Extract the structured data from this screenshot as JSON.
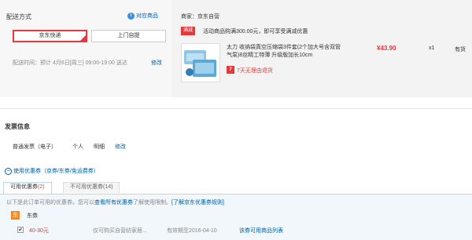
{
  "delivery": {
    "title": "配送方式",
    "help_icon": "info-icon",
    "help_link": "对应商品",
    "options": [
      {
        "label": "京东快递",
        "selected": true
      },
      {
        "label": "上门自提",
        "selected": false
      }
    ],
    "time_label": "配送时间：预计 4月6日[周三] 09:00-19:00 送达",
    "modify_link": "修改"
  },
  "merchant": {
    "label": "商家：京东自营",
    "promo_badge": "满减",
    "promo_text": "活动商品购满300.00元，即可享受满减优惠",
    "product": {
      "name": "太力 收纳袋真空压缩袋3件套(2个加大号含双管气泵)8丝精工特薄 升级版加长10cm",
      "price": "¥43.90",
      "qty": "x1",
      "stock": "有货",
      "return_icon": "7",
      "return_text": "7天无理由退货"
    }
  },
  "invoice": {
    "title": "发票信息",
    "type": "普通发票（电子）",
    "recipient": "个人",
    "content": "明细",
    "modify_link": "修改"
  },
  "coupon": {
    "toggle_icon": "−",
    "toggle_label": "使用优惠券（京券/东券/免运费券）",
    "tabs": [
      {
        "label": "可用优惠券",
        "count": "(2)",
        "active": true
      },
      {
        "label": "不可用优惠券",
        "count": "(14)",
        "active": false
      }
    ],
    "notice_prefix": "以下是此订单可用的优惠券。您可以",
    "notice_link1": "查看所有优惠券",
    "notice_mid": "了解使用限制。",
    "notice_link2": "[了解京东优惠券规则]",
    "category_icon": "东",
    "category_label": "东券",
    "items": [
      {
        "checked": true,
        "amount": "40-30元",
        "scope": "仅可购买自营纺家居...",
        "expire": "有效期至2016-04-10",
        "link": "该券可用商品列表"
      }
    ]
  },
  "colors": {
    "accent_red": "#e4393c",
    "link_blue": "#005ea7",
    "orange": "#f08a24"
  }
}
